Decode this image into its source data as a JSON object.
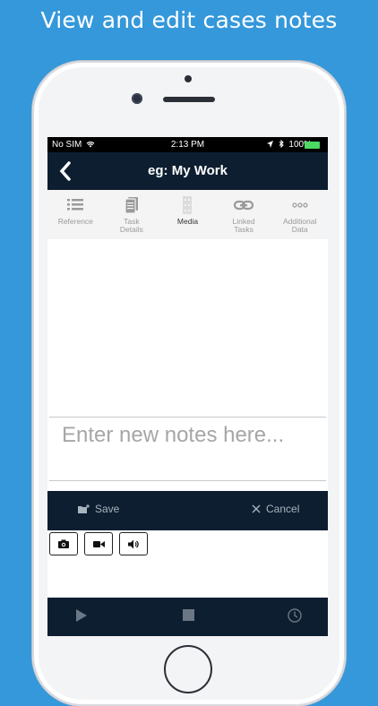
{
  "promo": {
    "headline": "View and edit cases notes"
  },
  "status_bar": {
    "carrier": "No SIM",
    "time": "2:13 PM",
    "battery": "100%"
  },
  "navbar": {
    "title": "eg: My Work",
    "back_icon": "chevron-left-icon"
  },
  "tabs": [
    {
      "label": "Reference",
      "icon": "list-icon",
      "active": false
    },
    {
      "label": "Task Details",
      "icon": "document-icon",
      "active": false
    },
    {
      "label": "Media",
      "icon": "film-icon",
      "active": true
    },
    {
      "label": "Linked Tasks",
      "icon": "link-icon",
      "active": false
    },
    {
      "label": "Additional Data",
      "icon": "ellipsis-icon",
      "active": false
    }
  ],
  "notes": {
    "placeholder": "Enter new notes here...",
    "value": ""
  },
  "actions": {
    "save_label": "Save",
    "cancel_label": "Cancel"
  },
  "media_tools": [
    {
      "icon": "camera-icon"
    },
    {
      "icon": "video-camera-icon"
    },
    {
      "icon": "speaker-icon"
    }
  ],
  "player": [
    {
      "icon": "play-icon"
    },
    {
      "icon": "stop-icon"
    },
    {
      "icon": "clock-icon"
    }
  ],
  "colors": {
    "background": "#3498db",
    "navbar": "#0d1e30",
    "active_tab": "#333333",
    "inactive_tab": "#9a9a9a"
  }
}
